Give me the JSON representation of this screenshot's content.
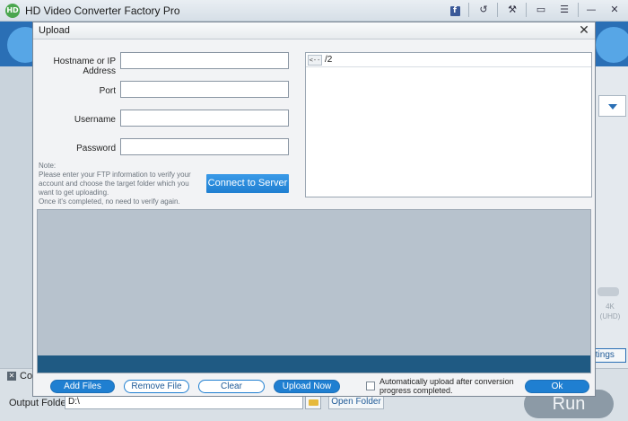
{
  "app": {
    "logo_text": "HD",
    "title": "HD Video Converter Factory Pro",
    "titlebar_icons": [
      "facebook-icon",
      "refresh-icon",
      "wrench-icon",
      "chat-icon",
      "menu-icon",
      "minimize-icon",
      "close-icon"
    ],
    "facebook_glyph": "f",
    "refresh_glyph": "↺",
    "wrench_glyph": "⚒",
    "chat_glyph": "▭",
    "menu_glyph": "☰",
    "minimize_glyph": "—",
    "close_glyph": "✕"
  },
  "main": {
    "merge_label": "Co",
    "merge_check_glyph": "✕",
    "output_folder_label": "Output Folder:",
    "output_folder_value": "D:\\",
    "open_folder_label": "Open Folder",
    "run_label": "Run",
    "settings_label": "ttings",
    "resolution_badge": "4K\n(UHD)",
    "colors": {
      "accent": "#1f7fd1",
      "toolbar": "#2a6fb5"
    }
  },
  "dialog": {
    "title": "Upload",
    "close_glyph": "✕",
    "fields": {
      "hostname_label": "Hostname or IP Address",
      "hostname_value": "",
      "port_label": "Port",
      "port_value": "",
      "username_label": "Username",
      "username_value": "",
      "password_label": "Password",
      "password_value": ""
    },
    "note": "Note:\nPlease enter your FTP information to verify your account and choose the target folder which you want to get uploading.\nOnce it's completed, no need to verify again.",
    "connect_label": "Connect to Server",
    "remote": {
      "back_label": "<--",
      "path": "/2"
    },
    "buttons": {
      "add_files": "Add Files",
      "remove_file": "Remove File",
      "clear": "Clear",
      "upload_now": "Upload Now",
      "ok": "Ok"
    },
    "auto_upload_label": "Automatically upload after conversion progress completed.",
    "auto_upload_checked": false
  }
}
